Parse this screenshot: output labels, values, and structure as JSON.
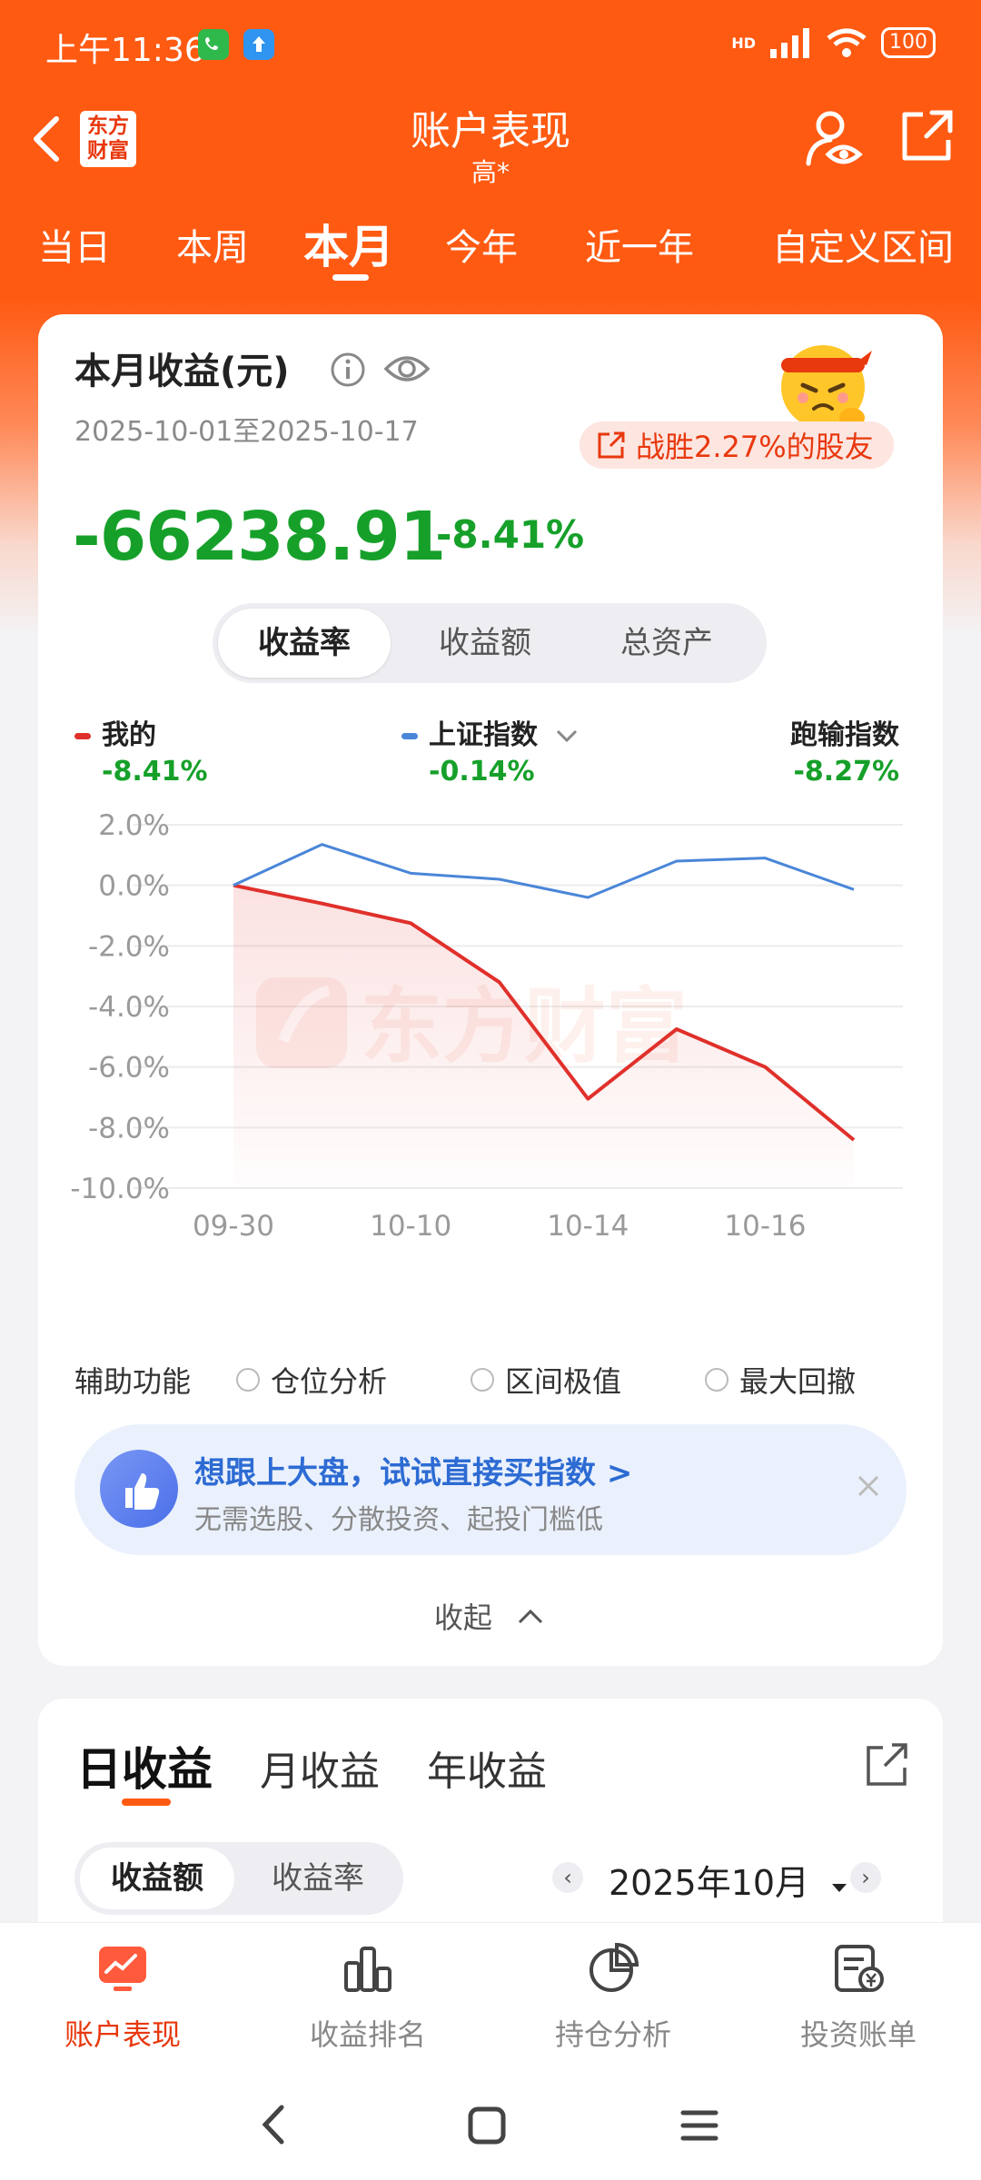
{
  "status_bar": {
    "time": "上午11:36",
    "network": "HD",
    "battery": "100"
  },
  "header": {
    "title": "账户表现",
    "subtitle": "高*",
    "logo_line1": "东方",
    "logo_line2": "财富"
  },
  "period_tabs": [
    "当日",
    "本周",
    "本月",
    "今年",
    "近一年",
    "自定义区间"
  ],
  "active_period": "本月",
  "summary": {
    "title": "本月收益(元)",
    "date_range": "2025-10-01至2025-10-17",
    "badge": "战胜2.27%的股友",
    "amount": "-66238.91",
    "percent": "-8.41%"
  },
  "segment": [
    "收益率",
    "收益额",
    "总资产"
  ],
  "legend": [
    {
      "name": "我的",
      "value": "-8.41%",
      "color": "#e0302b"
    },
    {
      "name": "上证指数",
      "value": "-0.14%",
      "color": "#4a86d8"
    },
    {
      "name": "跑输指数",
      "value": "-8.27%"
    }
  ],
  "chart_data": {
    "type": "line",
    "x": [
      "09-30",
      "10-09",
      "10-10",
      "10-13",
      "10-14",
      "10-15",
      "10-16",
      "10-17"
    ],
    "xtick_labels": [
      "09-30",
      "10-10",
      "10-14",
      "10-16"
    ],
    "ytick_labels": [
      "2.0%",
      "0.0%",
      "-2.0%",
      "-4.0%",
      "-6.0%",
      "-8.0%",
      "-10.0%"
    ],
    "ylim": [
      -10,
      2
    ],
    "series": [
      {
        "name": "我的",
        "color": "#e0302b",
        "values": [
          0,
          -0.6,
          -1.25,
          -3.2,
          -7.05,
          -4.75,
          -6.0,
          -8.41
        ]
      },
      {
        "name": "上证指数",
        "color": "#4a86d8",
        "values": [
          0,
          1.35,
          0.4,
          0.2,
          -0.4,
          0.8,
          0.9,
          -0.14
        ]
      }
    ],
    "watermark": "东方财富",
    "grid": true
  },
  "aux": {
    "label": "辅助功能",
    "options": [
      "仓位分析",
      "区间极值",
      "最大回撤"
    ]
  },
  "promo": {
    "title": "想跟上大盘，试试直接买指数 >",
    "subtitle": "无需选股、分散投资、起投门槛低"
  },
  "collapse_label": "收起",
  "earnings": {
    "tabs": [
      "日收益",
      "月收益",
      "年收益"
    ],
    "segment": [
      "收益额",
      "收益率"
    ],
    "month": "2025年10月"
  },
  "bottom_nav": [
    "账户表现",
    "收益排名",
    "持仓分析",
    "投资账单"
  ]
}
